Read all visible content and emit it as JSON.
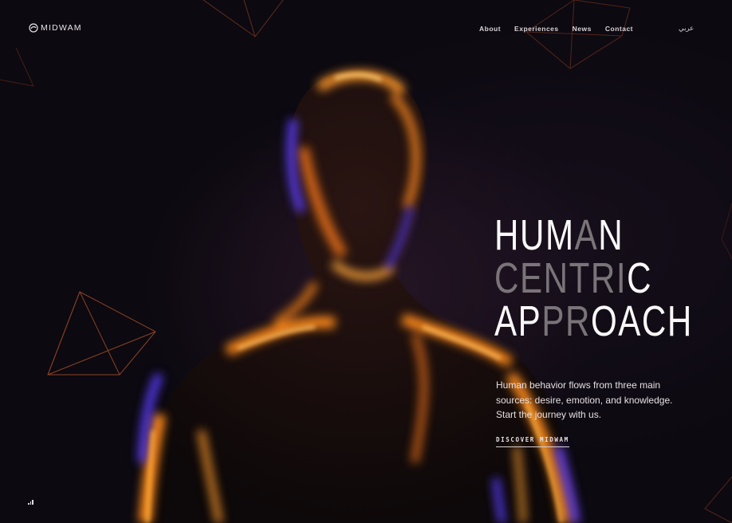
{
  "brand": {
    "name": "MIDWAM",
    "logo_icon": "midwam-swirl-logo-icon"
  },
  "nav": {
    "items": [
      "About",
      "Experiences",
      "News",
      "Contact"
    ],
    "language": "عربي"
  },
  "hero": {
    "headline_lines": [
      {
        "parts": [
          "HUM",
          "A",
          "N"
        ],
        "dim_index": 1
      },
      {
        "parts": [
          "",
          "CENTRI",
          "C"
        ],
        "dim_index": 1
      },
      {
        "parts": [
          "AP",
          "PR",
          "OACH"
        ],
        "dim_index": 1
      }
    ],
    "description": "Human behavior flows from three main sources: desire, emotion, and knowledge. Start the journey with us.",
    "cta_label": "DISCOVER MIDWAM"
  },
  "controls": {
    "sound_icon": "sound-bars-icon"
  },
  "colors": {
    "background": "#0c0910",
    "glow_orange": "#ff8a1f",
    "glow_blue": "#5a3cff",
    "text": "#ffffff",
    "dim_text": "#7a7479"
  }
}
